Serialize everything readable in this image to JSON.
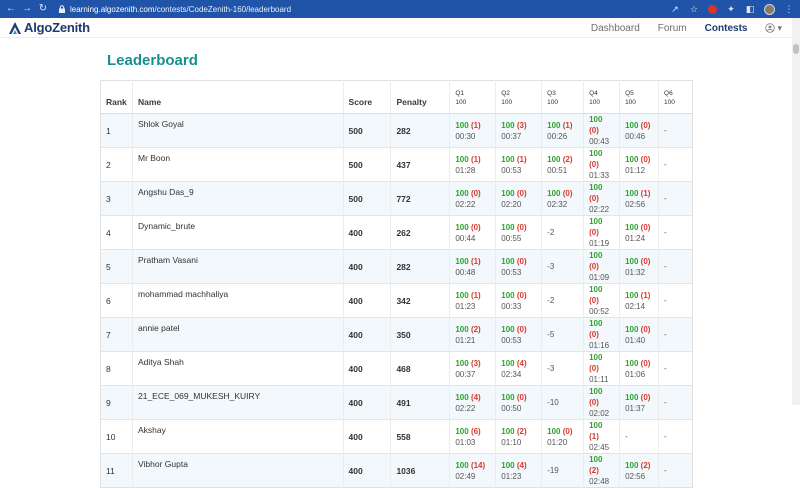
{
  "browser": {
    "url_host": "learning.algozenith.com",
    "url_path": "/contests/CodeZenith-160/leaderboard"
  },
  "site": {
    "logo_text": "AlgoZenith",
    "nav": [
      {
        "label": "Dashboard",
        "active": false
      },
      {
        "label": "Forum",
        "active": false
      },
      {
        "label": "Contests",
        "active": true
      }
    ]
  },
  "page": {
    "title": "Leaderboard"
  },
  "table": {
    "headers": {
      "rank": "Rank",
      "name": "Name",
      "score": "Score",
      "penalty": "Penalty"
    },
    "questions": [
      {
        "label": "Q1",
        "max": "100"
      },
      {
        "label": "Q2",
        "max": "100"
      },
      {
        "label": "Q3",
        "max": "100"
      },
      {
        "label": "Q4",
        "max": "100"
      },
      {
        "label": "Q5",
        "max": "100"
      },
      {
        "label": "Q6",
        "max": "100"
      }
    ],
    "rows": [
      {
        "rank": "1",
        "name": "Shlok Goyal",
        "score": "500",
        "penalty": "282",
        "cells": [
          {
            "score": "100",
            "wrong": "(1)",
            "time": "00:30"
          },
          {
            "score": "100",
            "wrong": "(3)",
            "time": "00:37"
          },
          {
            "score": "100",
            "wrong": "(1)",
            "time": "00:26"
          },
          {
            "score": "100",
            "wrong": "(0)",
            "time": "00:43"
          },
          {
            "score": "100",
            "wrong": "(0)",
            "time": "00:46"
          },
          {
            "plain": "-"
          }
        ]
      },
      {
        "rank": "2",
        "name": "Mr Boon",
        "score": "500",
        "penalty": "437",
        "cells": [
          {
            "score": "100",
            "wrong": "(1)",
            "time": "01:28"
          },
          {
            "score": "100",
            "wrong": "(1)",
            "time": "00:53"
          },
          {
            "score": "100",
            "wrong": "(2)",
            "time": "00:51"
          },
          {
            "score": "100",
            "wrong": "(0)",
            "time": "01:33"
          },
          {
            "score": "100",
            "wrong": "(0)",
            "time": "01:12"
          },
          {
            "plain": "-"
          }
        ]
      },
      {
        "rank": "3",
        "name": "Angshu Das_9",
        "score": "500",
        "penalty": "772",
        "cells": [
          {
            "score": "100",
            "wrong": "(0)",
            "time": "02:22"
          },
          {
            "score": "100",
            "wrong": "(0)",
            "time": "02:20"
          },
          {
            "score": "100",
            "wrong": "(0)",
            "time": "02:32"
          },
          {
            "score": "100",
            "wrong": "(0)",
            "time": "02:22"
          },
          {
            "score": "100",
            "wrong": "(1)",
            "time": "02:56"
          },
          {
            "plain": "-"
          }
        ]
      },
      {
        "rank": "4",
        "name": "Dynamic_brute",
        "score": "400",
        "penalty": "262",
        "cells": [
          {
            "score": "100",
            "wrong": "(0)",
            "time": "00:44"
          },
          {
            "score": "100",
            "wrong": "(0)",
            "time": "00:55"
          },
          {
            "plain": "-2"
          },
          {
            "score": "100",
            "wrong": "(0)",
            "time": "01:19"
          },
          {
            "score": "100",
            "wrong": "(0)",
            "time": "01:24"
          },
          {
            "plain": "-"
          }
        ]
      },
      {
        "rank": "5",
        "name": "Pratham Vasani",
        "score": "400",
        "penalty": "282",
        "cells": [
          {
            "score": "100",
            "wrong": "(1)",
            "time": "00:48"
          },
          {
            "score": "100",
            "wrong": "(0)",
            "time": "00:53"
          },
          {
            "plain": "-3"
          },
          {
            "score": "100",
            "wrong": "(0)",
            "time": "01:09"
          },
          {
            "score": "100",
            "wrong": "(0)",
            "time": "01:32"
          },
          {
            "plain": "-"
          }
        ]
      },
      {
        "rank": "6",
        "name": "mohammad machhaliya",
        "score": "400",
        "penalty": "342",
        "cells": [
          {
            "score": "100",
            "wrong": "(1)",
            "time": "01:23"
          },
          {
            "score": "100",
            "wrong": "(0)",
            "time": "00:33"
          },
          {
            "plain": "-2"
          },
          {
            "score": "100",
            "wrong": "(0)",
            "time": "00:52"
          },
          {
            "score": "100",
            "wrong": "(1)",
            "time": "02:14"
          },
          {
            "plain": "-"
          }
        ]
      },
      {
        "rank": "7",
        "name": "annie patel",
        "score": "400",
        "penalty": "350",
        "cells": [
          {
            "score": "100",
            "wrong": "(2)",
            "time": "01:21"
          },
          {
            "score": "100",
            "wrong": "(0)",
            "time": "00:53"
          },
          {
            "plain": "-5"
          },
          {
            "score": "100",
            "wrong": "(0)",
            "time": "01:16"
          },
          {
            "score": "100",
            "wrong": "(0)",
            "time": "01:40"
          },
          {
            "plain": "-"
          }
        ]
      },
      {
        "rank": "8",
        "name": "Aditya Shah",
        "score": "400",
        "penalty": "468",
        "cells": [
          {
            "score": "100",
            "wrong": "(3)",
            "time": "00:37"
          },
          {
            "score": "100",
            "wrong": "(4)",
            "time": "02:34"
          },
          {
            "plain": "-3"
          },
          {
            "score": "100",
            "wrong": "(0)",
            "time": "01:11"
          },
          {
            "score": "100",
            "wrong": "(0)",
            "time": "01:06"
          },
          {
            "plain": "-"
          }
        ]
      },
      {
        "rank": "9",
        "name": "21_ECE_069_MUKESH_KUIRY",
        "score": "400",
        "penalty": "491",
        "cells": [
          {
            "score": "100",
            "wrong": "(4)",
            "time": "02:22"
          },
          {
            "score": "100",
            "wrong": "(0)",
            "time": "00:50"
          },
          {
            "plain": "-10"
          },
          {
            "score": "100",
            "wrong": "(0)",
            "time": "02:02"
          },
          {
            "score": "100",
            "wrong": "(0)",
            "time": "01:37"
          },
          {
            "plain": "-"
          }
        ]
      },
      {
        "rank": "10",
        "name": "Akshay",
        "score": "400",
        "penalty": "558",
        "cells": [
          {
            "score": "100",
            "wrong": "(6)",
            "time": "01:03"
          },
          {
            "score": "100",
            "wrong": "(2)",
            "time": "01:10"
          },
          {
            "score": "100",
            "wrong": "(0)",
            "time": "01:20"
          },
          {
            "score": "100",
            "wrong": "(1)",
            "time": "02:45"
          },
          {
            "plain": "-"
          },
          {
            "plain": "-"
          }
        ]
      },
      {
        "rank": "11",
        "name": "Vibhor Gupta",
        "score": "400",
        "penalty": "1036",
        "cells": [
          {
            "score": "100",
            "wrong": "(14)",
            "time": "02:49"
          },
          {
            "score": "100",
            "wrong": "(4)",
            "time": "01:23"
          },
          {
            "plain": "-19"
          },
          {
            "score": "100",
            "wrong": "(2)",
            "time": "02:48"
          },
          {
            "score": "100",
            "wrong": "(2)",
            "time": "02:56"
          },
          {
            "plain": "-"
          }
        ]
      }
    ]
  },
  "colors": {
    "accent": "#16918e",
    "solved": "#2da32d",
    "wrong": "#d63b2f",
    "chrome": "#1f54a8"
  }
}
